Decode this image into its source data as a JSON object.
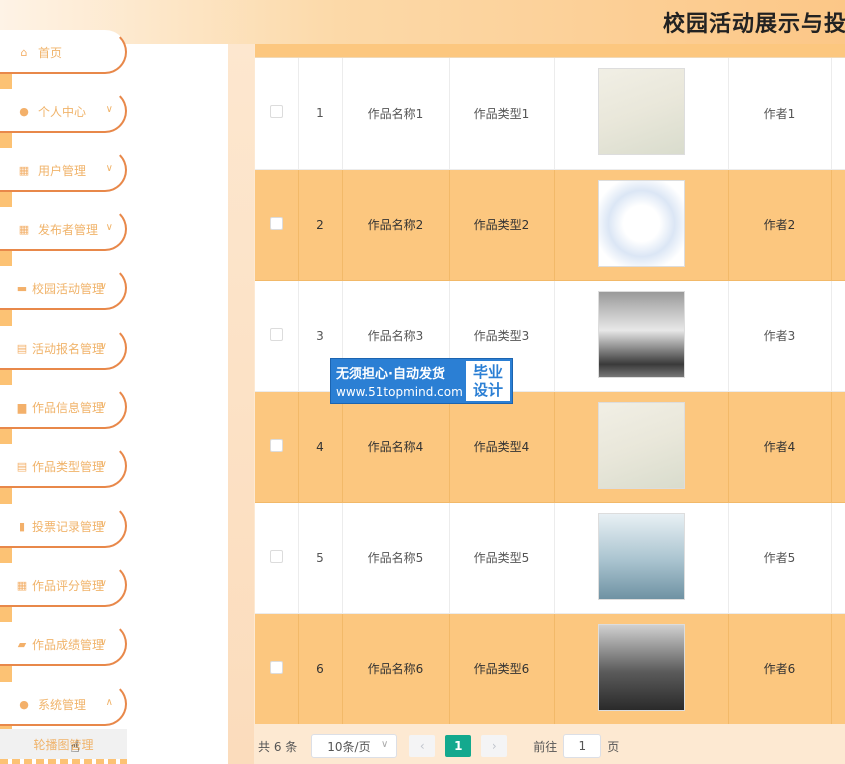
{
  "header": {
    "title": "校园活动展示与投票"
  },
  "sidebar": {
    "items": [
      {
        "label": "首页",
        "icon": "home-icon",
        "chevron": ""
      },
      {
        "label": "个人中心",
        "icon": "user-icon",
        "chevron": "∨"
      },
      {
        "label": "用户管理",
        "icon": "grid-icon",
        "chevron": "∨"
      },
      {
        "label": "发布者管理",
        "icon": "grid-icon",
        "chevron": "∨"
      },
      {
        "label": "校园活动管理",
        "icon": "monitor-icon",
        "chevron": "∨"
      },
      {
        "label": "活动报名管理",
        "icon": "clipboard-icon",
        "chevron": "∨"
      },
      {
        "label": "作品信息管理",
        "icon": "message-icon",
        "chevron": "∨"
      },
      {
        "label": "作品类型管理",
        "icon": "clipboard-icon",
        "chevron": "∨"
      },
      {
        "label": "投票记录管理",
        "icon": "bar-chart-icon",
        "chevron": "∨"
      },
      {
        "label": "作品评分管理",
        "icon": "grid-icon",
        "chevron": "∨"
      },
      {
        "label": "作品成绩管理",
        "icon": "ticket-icon",
        "chevron": "∨"
      },
      {
        "label": "系统管理",
        "icon": "bulb-icon",
        "chevron": "∧"
      }
    ],
    "sub_item": "轮播图管理"
  },
  "table": {
    "rows": [
      {
        "index": "1",
        "name": "作品名称1",
        "type": "作品类型1",
        "author": "作者1",
        "image": "landscape-mountains"
      },
      {
        "index": "2",
        "name": "作品名称2",
        "type": "作品类型2",
        "author": "作者2",
        "image": "goldfish-painting"
      },
      {
        "index": "3",
        "name": "作品名称3",
        "type": "作品类型3",
        "author": "作者3",
        "image": "snow-landscape"
      },
      {
        "index": "4",
        "name": "作品名称4",
        "type": "作品类型4",
        "author": "作者4",
        "image": "landscape-mountains"
      },
      {
        "index": "5",
        "name": "作品名称5",
        "type": "作品类型5",
        "author": "作者5",
        "image": "misty-mountains"
      },
      {
        "index": "6",
        "name": "作品名称6",
        "type": "作品类型6",
        "author": "作者6",
        "image": "ink-mountains"
      }
    ]
  },
  "pager": {
    "total": "共 6 条",
    "page_size": "10条/页",
    "prev": "‹",
    "current": "1",
    "next": "›",
    "goto_label": "前往",
    "goto_value": "1",
    "page_label": "页"
  },
  "watermark": {
    "line1": "无须担心·自动发货",
    "line2": "www.51topmind.com",
    "right_top": "毕业",
    "right_bottom": "设计"
  },
  "colors": {
    "accent": "#fcc77f",
    "border": "#e8884a",
    "pager_active": "#13a98e",
    "watermark": "#2b7fd4"
  }
}
